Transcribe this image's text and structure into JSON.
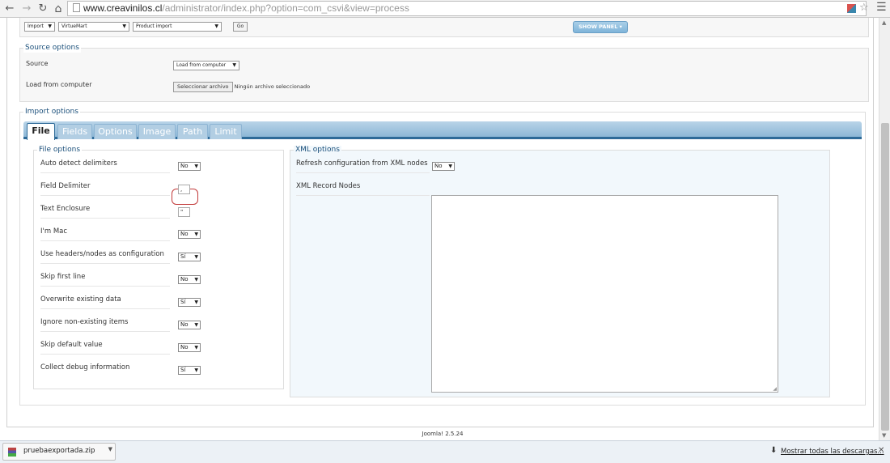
{
  "browser": {
    "url_host": "www.creavinilos.cl",
    "url_path": "/administrator/index.php?option=com_csvi&view=process",
    "icons": [
      "back-icon",
      "forward-icon",
      "reload-icon",
      "home-icon",
      "star-icon",
      "menu-icon"
    ]
  },
  "toolbar": {
    "action_select": "Import",
    "component_select": "VirtueMart",
    "template_select": "Product import",
    "go_label": "Go",
    "show_panel_label": "SHOW PANEL"
  },
  "source_options": {
    "legend": "Source options",
    "source_label": "Source",
    "source_value": "Load from computer",
    "load_label": "Load from computer",
    "choose_button": "Seleccionar archivo",
    "no_file_text": "Ningún archivo seleccionado"
  },
  "import_options": {
    "legend": "Import options",
    "tabs": [
      {
        "label": "File",
        "active": true
      },
      {
        "label": "Fields"
      },
      {
        "label": "Options"
      },
      {
        "label": "Image"
      },
      {
        "label": "Path"
      },
      {
        "label": "Limit"
      }
    ],
    "file_options": {
      "legend": "File options",
      "rows": [
        {
          "label": "Auto detect delimiters",
          "type": "select",
          "value": "No"
        },
        {
          "label": "Field Delimiter",
          "type": "text",
          "value": ","
        },
        {
          "label": "Text Enclosure",
          "type": "text",
          "value": "\""
        },
        {
          "label": "I'm Mac",
          "type": "select",
          "value": "No"
        },
        {
          "label": "Use headers/nodes as configuration",
          "type": "select",
          "value": "Sí"
        },
        {
          "label": "Skip first line",
          "type": "select",
          "value": "No"
        },
        {
          "label": "Overwrite existing data",
          "type": "select",
          "value": "Sí"
        },
        {
          "label": "Ignore non-existing items",
          "type": "select",
          "value": "No"
        },
        {
          "label": "Skip default value",
          "type": "select",
          "value": "No"
        },
        {
          "label": "Collect debug information",
          "type": "select",
          "value": "Sí"
        }
      ]
    },
    "xml_options": {
      "legend": "XML options",
      "refresh_label": "Refresh configuration from XML nodes",
      "refresh_value": "No",
      "record_nodes_label": "XML Record Nodes",
      "record_nodes_value": ""
    }
  },
  "footer": {
    "version": "Joomla! 2.5.24"
  },
  "downloads": {
    "file_name": "pruebaexportada.zip",
    "show_all": "Mostrar todas las descargas..."
  },
  "colors": {
    "accent": "#2d6a98",
    "legend": "#1a4f7a",
    "highlight": "#c23a3a"
  }
}
